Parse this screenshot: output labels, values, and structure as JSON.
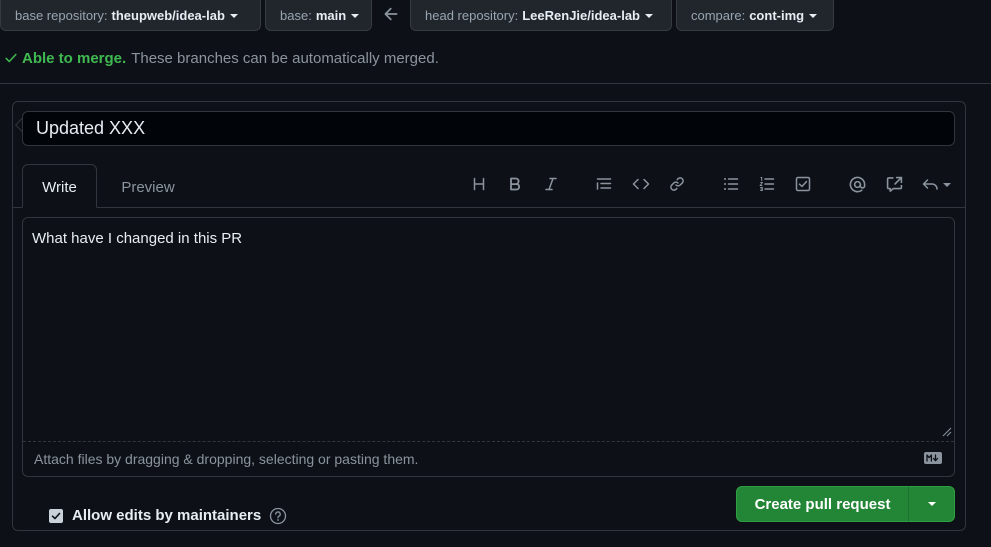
{
  "branches": {
    "base_repo_prefix": "base repository:",
    "base_repo_value": "theupweb/idea-lab",
    "base_prefix": "base:",
    "base_value": "main",
    "head_repo_prefix": "head repository:",
    "head_repo_value": "LeeRenJie/idea-lab",
    "compare_prefix": "compare:",
    "compare_value": "cont-img"
  },
  "merge_status": {
    "label": "Able to merge.",
    "message": "These branches can be automatically merged.",
    "color": "#3fb950"
  },
  "form": {
    "title_value": "Updated XXX",
    "tabs": [
      {
        "label": "Write",
        "active": true
      },
      {
        "label": "Preview",
        "active": false
      }
    ],
    "toolbar_icons": [
      "heading-icon",
      "bold-icon",
      "italic-icon",
      "quote-icon",
      "code-icon",
      "link-icon",
      "unordered-list-icon",
      "ordered-list-icon",
      "task-list-icon",
      "mention-icon",
      "reference-icon",
      "saved-replies-icon"
    ],
    "body_value": "What have I changed in this PR",
    "attach_hint": "Attach files by dragging & dropping, selecting or pasting them.",
    "allow_edits_label": "Allow edits by maintainers",
    "allow_edits_checked": true,
    "submit_label": "Create pull request",
    "accent_color": "#238636"
  }
}
